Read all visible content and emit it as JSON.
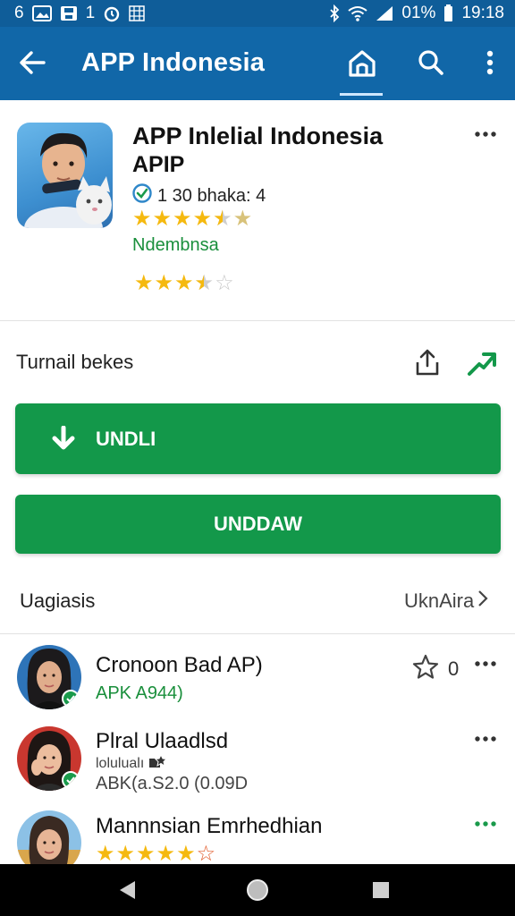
{
  "status_bar": {
    "left_text": "6",
    "notif_digit": "1",
    "battery": "01%",
    "time": "19:18"
  },
  "app_bar": {
    "title": "APP Indonesia",
    "icons": [
      "back-arrow-icon",
      "home-icon",
      "search-icon",
      "more-vert-icon"
    ],
    "background": "#1167a8"
  },
  "app": {
    "name": "APP Inlelial Indonesia",
    "subtitle": "APIP",
    "verified_text": "1 30 bhaka: 4",
    "developer": "Ndembnsa",
    "rating_1": 4.5,
    "rating_2": 3.5
  },
  "install": {
    "label": "Turnail bekes",
    "primary_button": "UNDLI",
    "secondary_button": "UNDDAW",
    "accent": "#13984a"
  },
  "related": {
    "title": "Uagiasis",
    "see_all": "UknAira",
    "items": [
      {
        "title": "Cronoon Bad AP)",
        "subtitle": "APK A944)",
        "star_count": "0"
      },
      {
        "title": "Plral Ulaadlsd",
        "meta": "lolulualı",
        "subtitle": "ABK(a.S2.0 (0.09D"
      },
      {
        "title": "Mannnsian Emrhedhian",
        "rating": 5
      }
    ]
  }
}
